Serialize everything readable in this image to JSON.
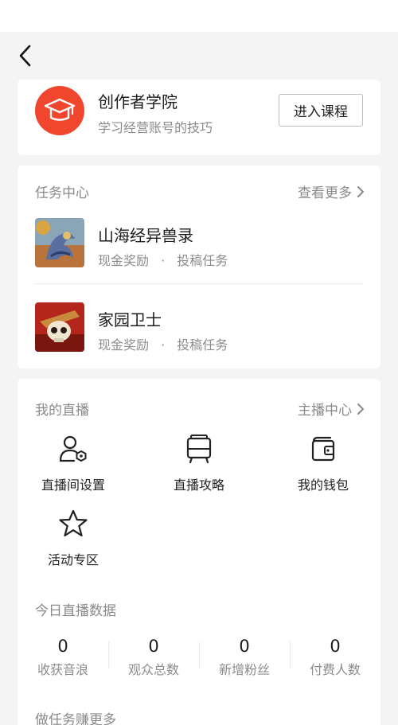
{
  "nav": {
    "back_icon": "chevron-left-icon"
  },
  "academy": {
    "icon": "graduation-cap-icon",
    "title": "创作者学院",
    "subtitle": "学习经营账号的技巧",
    "button_label": "进入课程",
    "accent_color": "#f0462d"
  },
  "task_center": {
    "title": "任务中心",
    "more_label": "查看更多",
    "items": [
      {
        "name": "山海经异兽录",
        "reward": "现金奖励",
        "separator": "·",
        "type": "投稿任务",
        "thumb": "dragon-game-thumbnail"
      },
      {
        "name": "家园卫士",
        "reward": "现金奖励",
        "separator": "·",
        "type": "投稿任务",
        "thumb": "skull-game-thumbnail"
      }
    ]
  },
  "live": {
    "title": "我的直播",
    "more_label": "主播中心",
    "tools": [
      {
        "label": "直播间设置",
        "icon": "user-settings-icon"
      },
      {
        "label": "直播攻略",
        "icon": "guide-board-icon"
      },
      {
        "label": "我的钱包",
        "icon": "wallet-icon"
      },
      {
        "label": "活动专区",
        "icon": "star-icon"
      }
    ],
    "today_title": "今日直播数据",
    "stats": [
      {
        "value": "0",
        "label": "收获音浪"
      },
      {
        "value": "0",
        "label": "观众总数"
      },
      {
        "value": "0",
        "label": "新增粉丝"
      },
      {
        "value": "0",
        "label": "付费人数"
      }
    ],
    "earn_title": "做任务赚更多"
  }
}
